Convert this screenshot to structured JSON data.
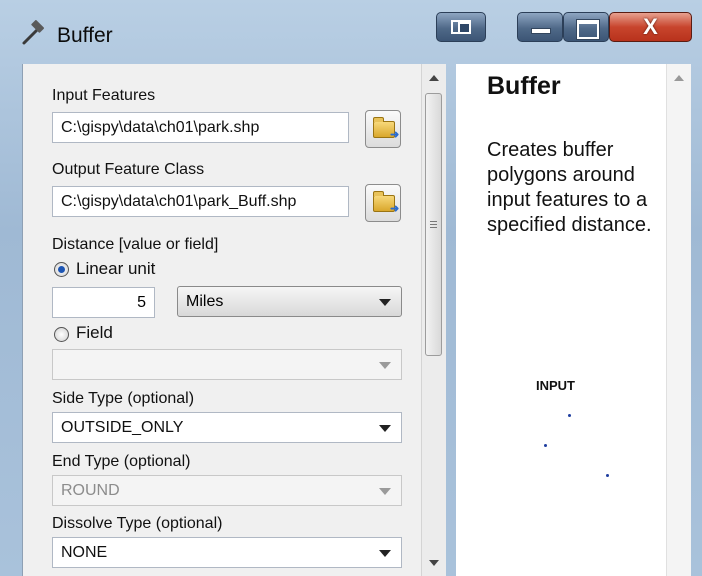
{
  "window": {
    "title": "Buffer",
    "icon": "hammer-icon",
    "buttons": {
      "system": "window-icon",
      "minimize": "minimize-icon",
      "maximize": "maximize-icon",
      "close": "X"
    }
  },
  "form": {
    "input_features": {
      "label": "Input Features",
      "value": "C:\\gispy\\data\\ch01\\park.shp"
    },
    "output_feature_class": {
      "label": "Output Feature Class",
      "value": "C:\\gispy\\data\\ch01\\park_Buff.shp"
    },
    "distance": {
      "label": "Distance [value or field]",
      "linear_unit_label": "Linear unit",
      "linear_unit_selected": true,
      "value": "5",
      "unit": "Miles",
      "field_label": "Field",
      "field_selected": false,
      "field_value": ""
    },
    "side_type": {
      "label": "Side Type (optional)",
      "value": "OUTSIDE_ONLY"
    },
    "end_type": {
      "label": "End Type (optional)",
      "value": "ROUND",
      "disabled": true
    },
    "dissolve_type": {
      "label": "Dissolve Type (optional)",
      "value": "NONE"
    }
  },
  "help": {
    "title": "Buffer",
    "description": "Creates buffer polygons around input features to a specified distance.",
    "diagram_label": "INPUT"
  },
  "colors": {
    "accent": "#1d55b3",
    "close_button": "#c8452d",
    "titlebar": "#a9c2db"
  }
}
